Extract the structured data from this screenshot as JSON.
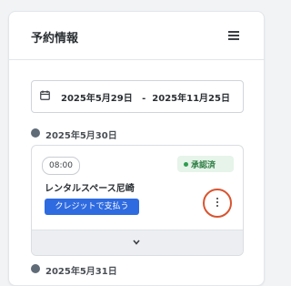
{
  "header": {
    "title": "予約情報",
    "menu_icon": "hamburger-menu-icon"
  },
  "date_range": {
    "icon": "calendar-icon",
    "start": "2025年5月29日",
    "separator": "-",
    "end": "2025年11月25日"
  },
  "groups": [
    {
      "date": "2025年5月30日",
      "reservation": {
        "time": "08:00",
        "status": "承認済",
        "status_color": "#2e9c4f",
        "place": "レンタルスペース尼崎",
        "pay_label": "クレジットで支払う",
        "more_icon": "more-vertical-icon",
        "expand_icon": "chevron-down-icon"
      }
    },
    {
      "date": "2025年5月31日"
    }
  ]
}
